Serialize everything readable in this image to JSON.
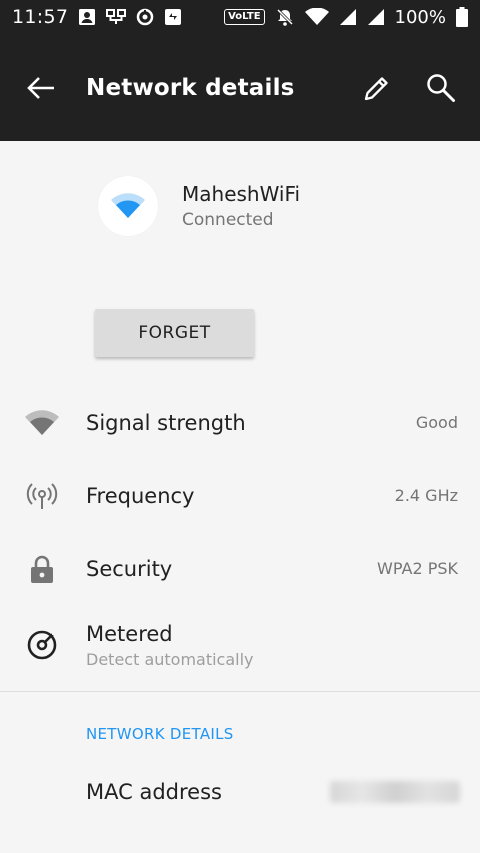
{
  "status_bar": {
    "time": "11:57",
    "network_type": "VoLTE",
    "battery": "100%"
  },
  "app_bar": {
    "title": "Network details",
    "icons": [
      "back-arrow-icon",
      "edit-pencil-icon",
      "search-icon"
    ]
  },
  "network": {
    "name": "MaheshWiFi",
    "status": "Connected",
    "accent_color": "#2196f3"
  },
  "forget_button": {
    "label": "FORGET"
  },
  "details": [
    {
      "label": "Signal strength",
      "value": "Good",
      "icon": "wifi-signal-icon"
    },
    {
      "label": "Frequency",
      "value": "2.4 GHz",
      "icon": "antenna-icon"
    },
    {
      "label": "Security",
      "value": "WPA2 PSK",
      "icon": "lock-icon"
    }
  ],
  "metered": {
    "label": "Metered",
    "sub": "Detect automatically",
    "icon": "metered-gauge-icon"
  },
  "section": {
    "title": "NETWORK DETAILS"
  },
  "mac": {
    "label": "MAC address"
  }
}
